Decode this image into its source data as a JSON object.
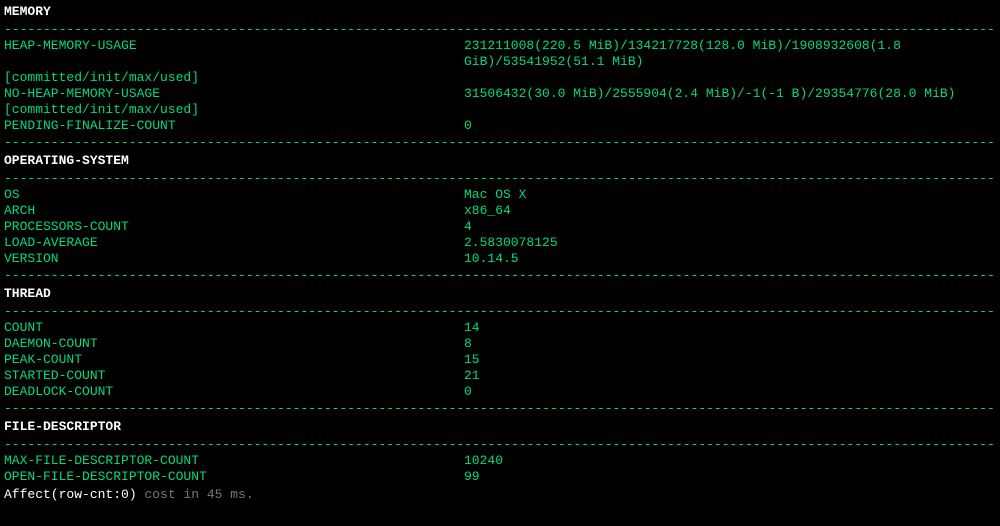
{
  "rule": "-------------------------------------------------------------------------------------------------------------------------------------------",
  "sections": {
    "memory": {
      "title": "MEMORY",
      "rows": [
        {
          "key": "HEAP-MEMORY-USAGE",
          "val": "231211008(220.5 MiB)/134217728(128.0 MiB)/1908932608(1.8 GiB)/53541952(51.1 MiB)"
        },
        {
          "key": "[committed/init/max/used]",
          "val": ""
        },
        {
          "key": "NO-HEAP-MEMORY-USAGE",
          "val": "31506432(30.0 MiB)/2555904(2.4 MiB)/-1(-1 B)/29354776(28.0 MiB)"
        },
        {
          "key": "[committed/init/max/used]",
          "val": ""
        },
        {
          "key": "PENDING-FINALIZE-COUNT",
          "val": "0"
        }
      ]
    },
    "os": {
      "title": "OPERATING-SYSTEM",
      "rows": [
        {
          "key": "OS",
          "val": "Mac OS X"
        },
        {
          "key": "ARCH",
          "val": "x86_64"
        },
        {
          "key": "PROCESSORS-COUNT",
          "val": "4"
        },
        {
          "key": "LOAD-AVERAGE",
          "val": "2.5830078125"
        },
        {
          "key": "VERSION",
          "val": "10.14.5"
        }
      ]
    },
    "thread": {
      "title": "THREAD",
      "rows": [
        {
          "key": "COUNT",
          "val": "14"
        },
        {
          "key": "DAEMON-COUNT",
          "val": "8"
        },
        {
          "key": "PEAK-COUNT",
          "val": "15"
        },
        {
          "key": "STARTED-COUNT",
          "val": "21"
        },
        {
          "key": "DEADLOCK-COUNT",
          "val": "0"
        }
      ]
    },
    "fd": {
      "title": "FILE-DESCRIPTOR",
      "rows": [
        {
          "key": "MAX-FILE-DESCRIPTOR-COUNT",
          "val": "10240"
        },
        {
          "key": "OPEN-FILE-DESCRIPTOR-COUNT",
          "val": "99"
        }
      ]
    }
  },
  "status": {
    "prefix": "Affect(row-cnt:0)",
    "suffix": " cost in 45 ms."
  }
}
